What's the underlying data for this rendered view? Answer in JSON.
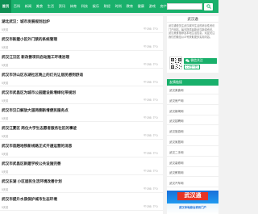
{
  "nav": {
    "items": [
      "首页",
      "百科",
      "新闻",
      "美食",
      "生活",
      "资讯",
      "体育",
      "科技",
      "娱乐",
      "财经",
      "时尚",
      "教育",
      "健康",
      "游戏",
      "房产",
      "汽车"
    ],
    "active_index": 0
  },
  "search": {
    "placeholder": ""
  },
  "articles": [
    {
      "title": "湖北武汉：城市发展规划出炉",
      "meta": "5天前",
      "views": "295",
      "comments": "0"
    },
    {
      "title": "武汉市新建小区外门禁的系统管理",
      "meta": "5天前",
      "views": "296",
      "comments": "0"
    },
    {
      "title": "武汉江汉区 新改善项目启动施工环境治理",
      "meta": "5天前",
      "views": "295",
      "comments": "0"
    },
    {
      "title": "武汉市洪山区东湖社区晚上的灯光让居民感到舒适",
      "meta": "5天前",
      "views": "295",
      "comments": "0"
    },
    {
      "title": "武汉市武昌区为城市公园建设新增绿化带规划",
      "meta": "5天前",
      "views": "295",
      "comments": "0"
    },
    {
      "title": "武汉市汉口解放大道两侧新增便民服务点",
      "meta": "5天前",
      "views": "295",
      "comments": "0"
    },
    {
      "title": "武汉江夏区 两位大学生志愿者服务社区的事迹",
      "meta": "5天前",
      "views": "295",
      "comments": "0"
    },
    {
      "title": "武汉市首趟地铁新线路正式开通运营的消息",
      "meta": "5天前",
      "views": "295",
      "comments": "0"
    },
    {
      "title": "武汉市武昌区新建学校公共设施完善",
      "meta": "5天前",
      "views": "295",
      "comments": "0"
    },
    {
      "title": "武汉东湖 小区居民生活环境改善计划",
      "meta": "5天前",
      "views": "295",
      "comments": "0"
    },
    {
      "title": "武汉市提升水质保护城市生态环境",
      "meta": "5天前",
      "views": "295",
      "comments": "0"
    }
  ],
  "sidebar": {
    "wx_card": {
      "title": "武汉通",
      "desc": "武汉通是关注武汉城市生活的综合性资讯门户网站，每天提供最新武汉新闻资讯、武汉美食推荐及本地生活信息，欢迎关注我们的微信公众号获取更多实用内容。",
      "wx_button": "微信关注",
      "scan_button": "扫一扫"
    },
    "links": {
      "header": "友情链接",
      "items": [
        "武汉美食网",
        "武汉房产网",
        "武汉新闻网",
        "武汉招聘网",
        "武汉旅游网",
        "武汉家居网",
        "武汉二手网",
        "武汉装修网",
        "武汉教育网",
        "武汉汽车网"
      ]
    },
    "banner": {
      "title": "武汉通",
      "subtitle": "武汉本地综合资讯门户"
    }
  },
  "colors": {
    "brand_green": "#19b06b",
    "nav_active": "#0e8f53",
    "banner_red": "#e63324"
  }
}
